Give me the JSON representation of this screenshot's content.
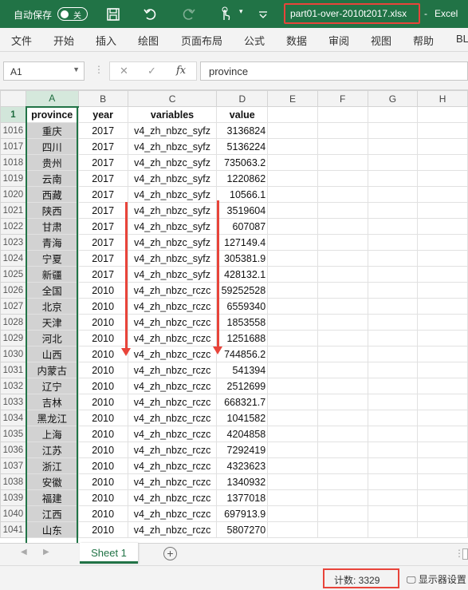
{
  "titlebar": {
    "autosave_label": "自动保存",
    "autosave_state": "关",
    "filename": "part01-over-2010t2017.xlsx",
    "separator": "-",
    "app_name": "Excel"
  },
  "ribbon_tabs": [
    "文件",
    "开始",
    "插入",
    "绘图",
    "页面布局",
    "公式",
    "数据",
    "审阅",
    "视图",
    "帮助",
    "BL"
  ],
  "formula_bar": {
    "name_box": "A1",
    "fx": "fx",
    "content": "province"
  },
  "columns": [
    "A",
    "B",
    "C",
    "D",
    "E",
    "F",
    "G",
    "H"
  ],
  "header_row": {
    "row": "1",
    "cells": [
      "province",
      "year",
      "variables",
      "value"
    ]
  },
  "rows": [
    [
      "1016",
      "重庆",
      "2017",
      "v4_zh_nbzc_syfz",
      "3136824"
    ],
    [
      "1017",
      "四川",
      "2017",
      "v4_zh_nbzc_syfz",
      "5136224"
    ],
    [
      "1018",
      "贵州",
      "2017",
      "v4_zh_nbzc_syfz",
      "735063.2"
    ],
    [
      "1019",
      "云南",
      "2017",
      "v4_zh_nbzc_syfz",
      "1220862"
    ],
    [
      "1020",
      "西藏",
      "2017",
      "v4_zh_nbzc_syfz",
      "10566.1"
    ],
    [
      "1021",
      "陕西",
      "2017",
      "v4_zh_nbzc_syfz",
      "3519604"
    ],
    [
      "1022",
      "甘肃",
      "2017",
      "v4_zh_nbzc_syfz",
      "607087"
    ],
    [
      "1023",
      "青海",
      "2017",
      "v4_zh_nbzc_syfz",
      "127149.4"
    ],
    [
      "1024",
      "宁夏",
      "2017",
      "v4_zh_nbzc_syfz",
      "305381.9"
    ],
    [
      "1025",
      "新疆",
      "2017",
      "v4_zh_nbzc_syfz",
      "428132.1"
    ],
    [
      "1026",
      "全国",
      "2010",
      "v4_zh_nbzc_rczc",
      "59252528"
    ],
    [
      "1027",
      "北京",
      "2010",
      "v4_zh_nbzc_rczc",
      "6559340"
    ],
    [
      "1028",
      "天津",
      "2010",
      "v4_zh_nbzc_rczc",
      "1853558"
    ],
    [
      "1029",
      "河北",
      "2010",
      "v4_zh_nbzc_rczc",
      "1251688"
    ],
    [
      "1030",
      "山西",
      "2010",
      "v4_zh_nbzc_rczc",
      "744856.2"
    ],
    [
      "1031",
      "内蒙古",
      "2010",
      "v4_zh_nbzc_rczc",
      "541394"
    ],
    [
      "1032",
      "辽宁",
      "2010",
      "v4_zh_nbzc_rczc",
      "2512699"
    ],
    [
      "1033",
      "吉林",
      "2010",
      "v4_zh_nbzc_rczc",
      "668321.7"
    ],
    [
      "1034",
      "黑龙江",
      "2010",
      "v4_zh_nbzc_rczc",
      "1041582"
    ],
    [
      "1035",
      "上海",
      "2010",
      "v4_zh_nbzc_rczc",
      "4204858"
    ],
    [
      "1036",
      "江苏",
      "2010",
      "v4_zh_nbzc_rczc",
      "7292419"
    ],
    [
      "1037",
      "浙江",
      "2010",
      "v4_zh_nbzc_rczc",
      "4323623"
    ],
    [
      "1038",
      "安徽",
      "2010",
      "v4_zh_nbzc_rczc",
      "1340932"
    ],
    [
      "1039",
      "福建",
      "2010",
      "v4_zh_nbzc_rczc",
      "1377018"
    ],
    [
      "1040",
      "江西",
      "2010",
      "v4_zh_nbzc_rczc",
      "697913.9"
    ],
    [
      "1041",
      "山东",
      "2010",
      "v4_zh_nbzc_rczc",
      "5807270"
    ]
  ],
  "sheet_tab": "Sheet 1",
  "statusbar": {
    "count": "计数: 3329",
    "display_settings": "显示器设置"
  },
  "colors": {
    "excel_green": "#217346",
    "highlight_red": "#e8443a"
  }
}
